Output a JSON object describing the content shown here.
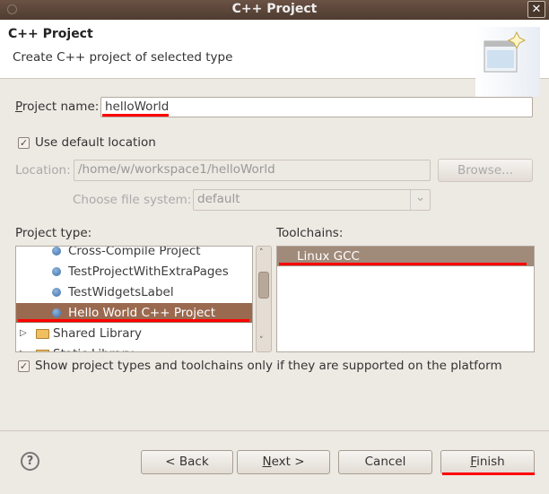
{
  "window": {
    "title": "C++ Project",
    "close_icon": "close-icon"
  },
  "header": {
    "title": "C++ Project",
    "subtitle": "Create C++ project of selected type",
    "icon": "new-project-wizard-icon"
  },
  "form": {
    "project_name_label": "Project name:",
    "project_name_value": "helloWorld",
    "use_default_location_label": "Use default location",
    "use_default_location_checked": true,
    "location_label": "Location:",
    "location_value": "/home/w/workspace1/helloWorld",
    "browse_label": "Browse...",
    "file_system_label": "Choose file system:",
    "file_system_value": "default"
  },
  "project_type": {
    "label": "Project type:",
    "items": [
      {
        "label": "Cross-Compile Project",
        "icon": "bullet-icon"
      },
      {
        "label": "TestProjectWithExtraPages",
        "icon": "bullet-icon"
      },
      {
        "label": "TestWidgetsLabel",
        "icon": "bullet-icon"
      },
      {
        "label": "Hello World C++ Project",
        "icon": "bullet-icon",
        "selected": true
      },
      {
        "label": "Shared Library",
        "icon": "folder-icon"
      },
      {
        "label": "Static Library",
        "icon": "folder-icon"
      }
    ]
  },
  "toolchains": {
    "label": "Toolchains:",
    "items": [
      {
        "label": "Linux GCC",
        "selected": true
      }
    ]
  },
  "show_supported_label": "Show project types and toolchains only if they are supported on the platform",
  "show_supported_checked": true,
  "buttons": {
    "back": "< Back",
    "next": "Next >",
    "cancel": "Cancel",
    "finish": "Finish"
  },
  "colors": {
    "selection": "#9a6a50",
    "annotation": "#ff0000",
    "titlebar": "#5a4338"
  }
}
